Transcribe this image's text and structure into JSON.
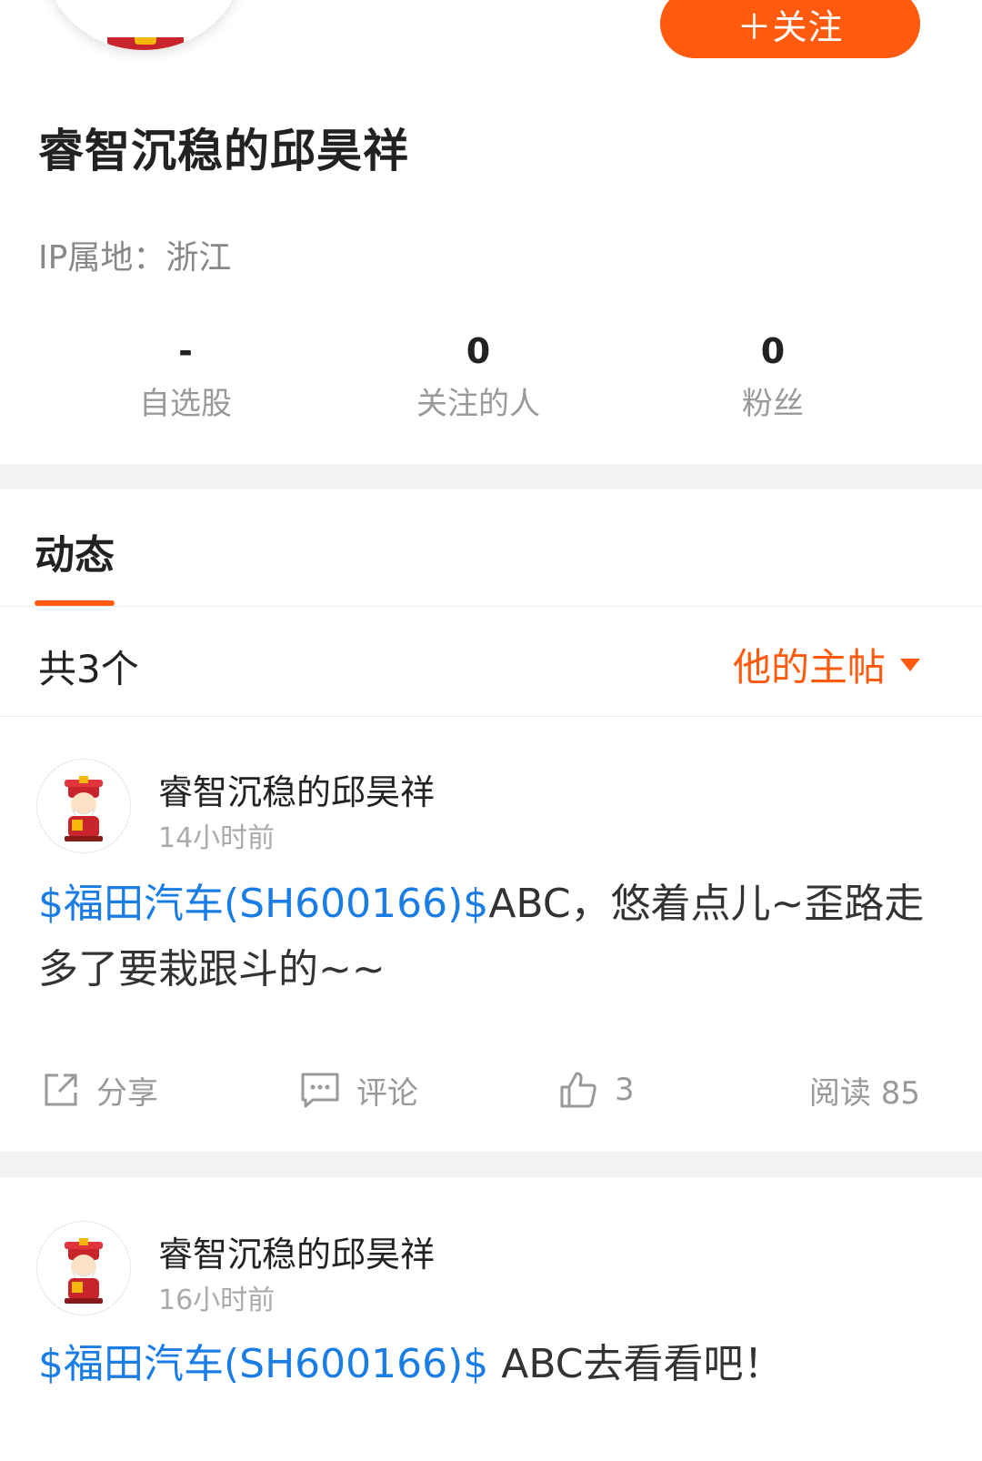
{
  "header": {
    "follow_label": "＋关注",
    "name": "睿智沉稳的邱昊祥",
    "ip_location": "IP属地：浙江"
  },
  "stats": [
    {
      "value": "-",
      "label": "自选股"
    },
    {
      "value": "0",
      "label": "关注的人"
    },
    {
      "value": "0",
      "label": "粉丝"
    }
  ],
  "tabs": {
    "active": "动态"
  },
  "feed": {
    "total": "共3个",
    "filter_label": "他的主帖"
  },
  "posts": [
    {
      "author": "睿智沉稳的邱昊祥",
      "time": "14小时前",
      "stock": "$福田汽车(SH600166)$",
      "text": "ABC，悠着点儿~歪路走多了要栽跟斗的~~",
      "share_label": "分享",
      "comment_label": "评论",
      "likes": "3",
      "reads": "阅读 85"
    },
    {
      "author": "睿智沉稳的邱昊祥",
      "time": "16小时前",
      "stock": "$福田汽车(SH600166)$",
      "text": " ABC去看看吧！"
    }
  ],
  "colors": {
    "accent": "#ff5a0d",
    "link": "#1a7de6",
    "divider": "#f3f3f3"
  }
}
